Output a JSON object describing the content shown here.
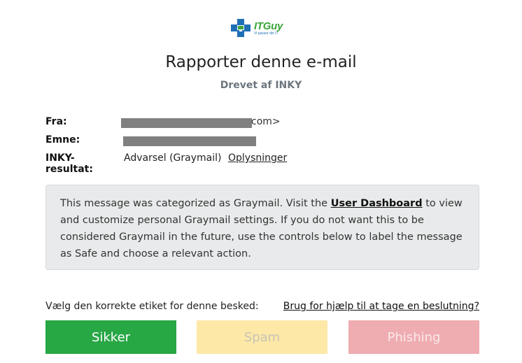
{
  "logo": {
    "name": "ITGuy",
    "tagline": "Vi passer din IT"
  },
  "header": {
    "title": "Rapporter denne e-mail",
    "subtitle": "Drevet af INKY"
  },
  "meta": {
    "from_label": "Fra:",
    "from_suffix": "com>",
    "subject_label": "Emne:",
    "result_label": "INKY-resultat:",
    "result_value": "Advarsel (Graymail)",
    "details_link": "Oplysninger"
  },
  "notice": {
    "text_before": "This message was categorized as Graymail. Visit the ",
    "link": "User Dashboard",
    "text_after": " to view and customize personal Graymail settings. If you do not want this to be considered Graymail in the future, use the controls below to label the message as Safe and choose a relevant action."
  },
  "actions": {
    "prompt": "Vælg den korrekte etiket for denne besked:",
    "help_link": "Brug for hjælp til at tage en beslutning?",
    "safe_label": "Sikker",
    "spam_label": "Spam",
    "phishing_label": "Phishing"
  },
  "colors": {
    "safe": "#28a745",
    "spam": "#fde8a8",
    "phishing": "#efacb1",
    "notice_bg": "#e9eaeb",
    "logo_blue": "#1f6fb6",
    "logo_green": "#3aa53a"
  }
}
